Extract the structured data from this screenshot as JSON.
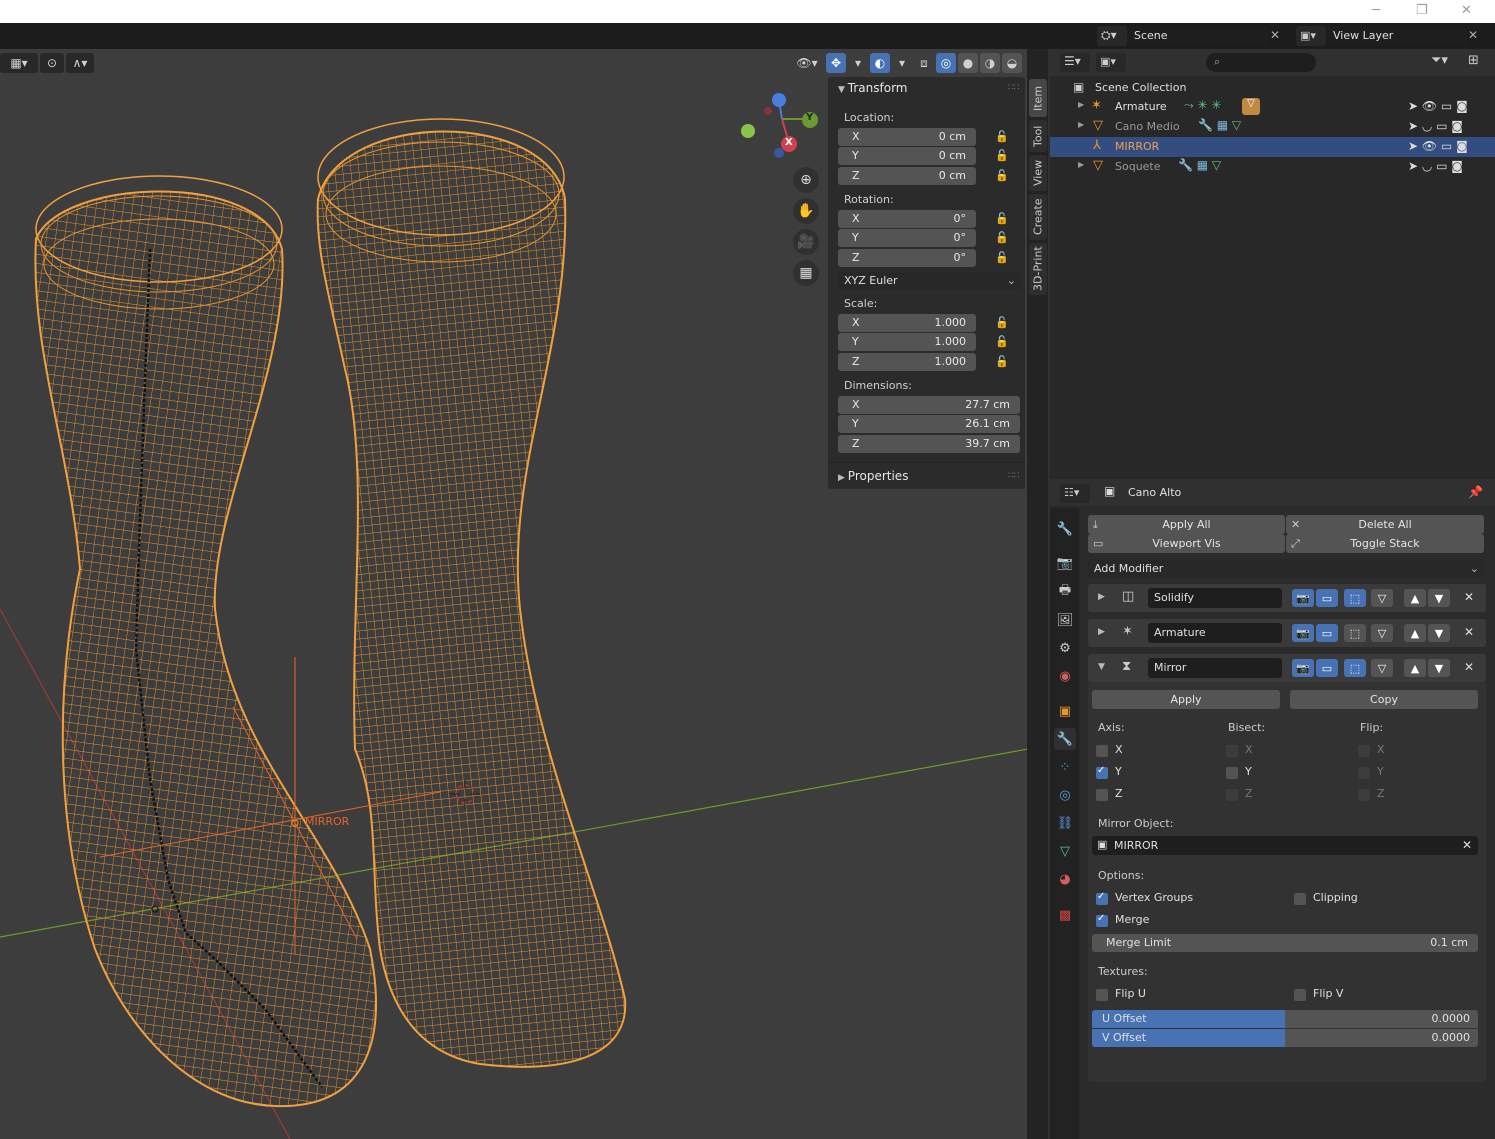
{
  "window": {
    "minimize": "─",
    "maximize": "❐",
    "close": "✕"
  },
  "topbar": {
    "scene_label": "Scene",
    "view_layer_label": "View Layer"
  },
  "viewport": {
    "object_label": "MIRROR",
    "gizmo": {
      "x": "X",
      "y": "Y"
    },
    "n_panel": {
      "transform_title": "Transform",
      "location_label": "Location:",
      "location": {
        "x": "0 cm",
        "y": "0 cm",
        "z": "0 cm"
      },
      "rotation_label": "Rotation:",
      "rotation": {
        "x": "0°",
        "y": "0°",
        "z": "0°"
      },
      "rotation_mode": "XYZ Euler",
      "scale_label": "Scale:",
      "scale": {
        "x": "1.000",
        "y": "1.000",
        "z": "1.000"
      },
      "dimensions_label": "Dimensions:",
      "dimensions": {
        "x": "27.7 cm",
        "y": "26.1 cm",
        "z": "39.7 cm"
      },
      "properties_title": "Properties",
      "axes": {
        "x": "X",
        "y": "Y",
        "z": "Z"
      }
    },
    "side_tabs": [
      "Item",
      "Tool",
      "View",
      "Create",
      "3D-Print"
    ]
  },
  "outliner": {
    "collection": "Scene Collection",
    "items": [
      {
        "name": "Armature"
      },
      {
        "name": "Cano Medio"
      },
      {
        "name": "MIRROR"
      },
      {
        "name": "Soquete"
      }
    ]
  },
  "properties": {
    "object_name": "Cano Alto",
    "apply_all": "Apply All",
    "delete_all": "Delete All",
    "viewport_vis": "Viewport Vis",
    "toggle_stack": "Toggle Stack",
    "add_modifier": "Add Modifier",
    "modifiers": [
      {
        "name": "Solidify"
      },
      {
        "name": "Armature"
      },
      {
        "name": "Mirror"
      }
    ],
    "mirror": {
      "apply": "Apply",
      "copy": "Copy",
      "axis_label": "Axis:",
      "bisect_label": "Bisect:",
      "flip_label": "Flip:",
      "axes": [
        "X",
        "Y",
        "Z"
      ],
      "axis_checked": [
        false,
        true,
        false
      ],
      "mirror_object_label": "Mirror Object:",
      "mirror_object": "MIRROR",
      "options_label": "Options:",
      "vertex_groups": "Vertex Groups",
      "clipping": "Clipping",
      "merge": "Merge",
      "merge_limit_label": "Merge Limit",
      "merge_limit": "0.1 cm",
      "textures_label": "Textures:",
      "flip_u": "Flip U",
      "flip_v": "Flip V",
      "u_offset_label": "U Offset",
      "u_offset": "0.0000",
      "v_offset_label": "V Offset",
      "v_offset": "0.0000"
    }
  },
  "colors": {
    "accent": "#4772b3",
    "wire": "#e8952e",
    "selected_text": "#f0a050"
  }
}
